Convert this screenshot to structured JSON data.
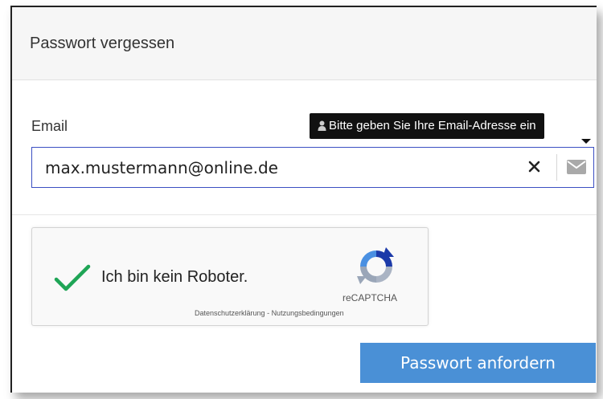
{
  "dialog": {
    "title": "Passwort vergessen"
  },
  "email": {
    "label": "Email",
    "value": "max.mustermann@online.de",
    "tooltip": "Bitte geben Sie Ihre Email-Adresse ein",
    "clear_glyph": "✕"
  },
  "captcha": {
    "checkbox_label": "Ich bin kein Roboter.",
    "brand": "reCAPTCHA",
    "privacy_link": "Datenschutzerklärung",
    "link_separator": " - ",
    "terms_link": "Nutzungsbedingungen",
    "checked": true
  },
  "actions": {
    "submit_label": "Passwort anfordern"
  },
  "icons": {
    "tooltip": "user-icon",
    "clear": "close-icon",
    "field": "envelope-icon",
    "captcha_check": "checkmark-icon",
    "captcha_logo": "recaptcha-logo-icon"
  },
  "colors": {
    "accent_button": "#4a90d6",
    "input_border": "#3b4fc2",
    "check_green": "#1fa556",
    "tooltip_bg": "#111111"
  }
}
